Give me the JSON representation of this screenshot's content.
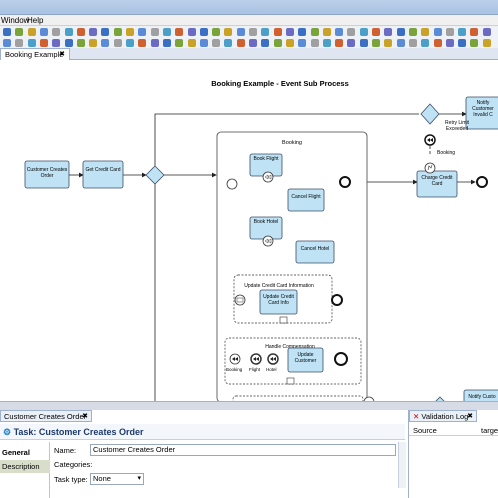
{
  "menu": {
    "window": "Window",
    "help": "Help"
  },
  "editor_tab": {
    "label": "Booking Example",
    "close": "✖"
  },
  "diagram": {
    "title": "Booking Example - Event Sub Process",
    "tasks": {
      "customer_creates_order": "Customer Creates Order",
      "get_credit_card": "Get Credit Card",
      "book_flight": "Book Flight",
      "cancel_flight": "Cancel Flight",
      "book_hotel": "Book Hotel",
      "cancel_hotel": "Cancel Hotel",
      "update_credit_card_info": "Update Credit Card Info",
      "update_customer": "Update Customer",
      "charge_credit_card": "Charge Credit Card",
      "notify_customer_invalid": "Notify Customer Invalid C",
      "notify_customer_bottom": "Notify Custo"
    },
    "subprocesses": {
      "booking": "Booking",
      "update_credit_card_information": "Update Credit Card Information",
      "handle_compensation": "Handle Compensation"
    },
    "labels": {
      "retry_limit_exceeded": "Retry Limit Exceeded",
      "booking_event": "Booking",
      "comp_booking": "Booking",
      "comp_flight": "Flight",
      "comp_hotel": "Hotel"
    }
  },
  "properties": {
    "tab_label": "Customer Creates Order",
    "close": "✖",
    "header": "Task: Customer Creates Order",
    "side_items": [
      "General",
      "Description"
    ],
    "fields": {
      "name_label": "Name:",
      "name_value": "Customer Creates Order",
      "categories_label": "Categories:",
      "task_type_label": "Task type:",
      "task_type_value": "None"
    }
  },
  "validation_log": {
    "tab_label": "Validation Log",
    "close": "✖",
    "columns": [
      "Source",
      "target"
    ]
  },
  "colors": {
    "task_fill": "#bfe3f5",
    "task_stroke": "#3c4d66",
    "accent": "#1c3a6e"
  }
}
